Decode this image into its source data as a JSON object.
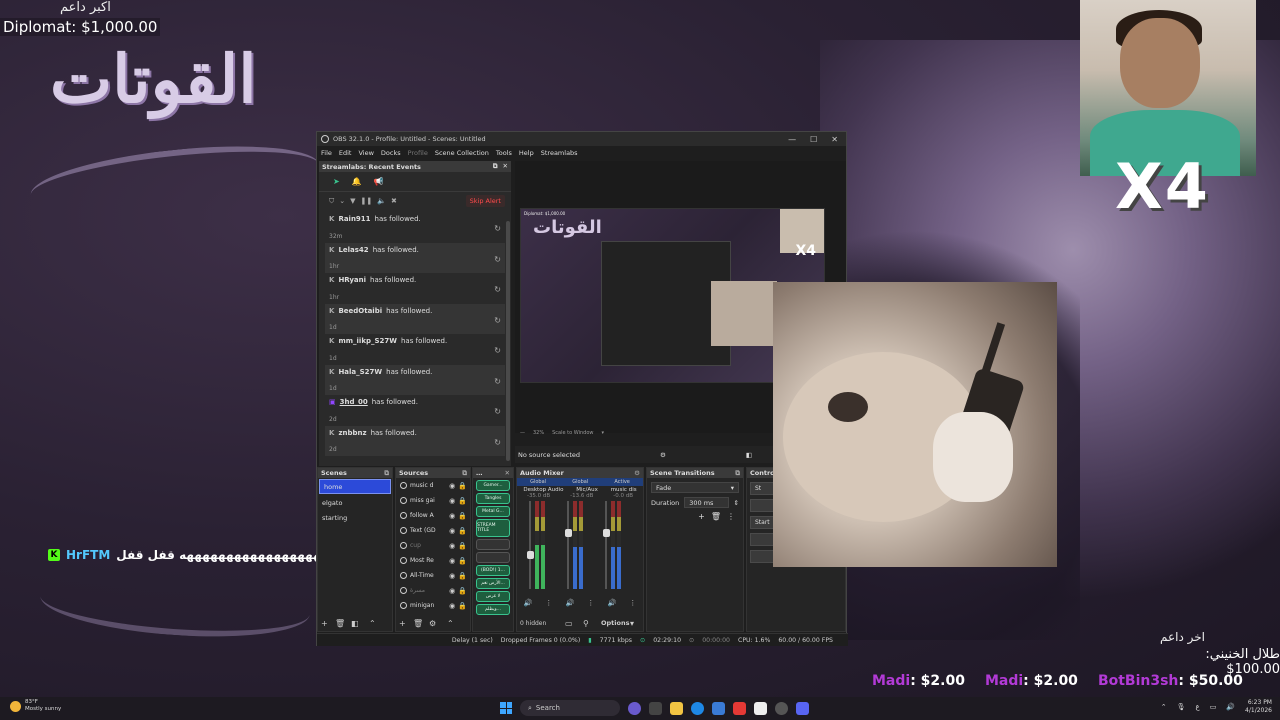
{
  "overlay": {
    "top_left_label": "اكبر داعم",
    "top_left_diplomat": "Diplomat: $1,000.00",
    "big_title": "القوتات",
    "cam_badge": "X4",
    "chat": {
      "user": "HrFTM",
      "message": "ههههههههههههههههههههه قفل قفل"
    },
    "bottom_right_label": "اخر داعم",
    "bottom_right_amount": "طلال الخنيني: 100.00$",
    "donors": [
      {
        "name": "Madi",
        "amount": ": $2.00"
      },
      {
        "name": "Madi",
        "amount": ": $2.00"
      },
      {
        "name": "BotBin3sh",
        "amount": ": $50.00"
      }
    ]
  },
  "obs": {
    "title": "OBS 32.1.0 - Profile: Untitled - Scenes: Untitled",
    "menu": [
      "File",
      "Edit",
      "View",
      "Docks",
      "Profile",
      "Scene Collection",
      "Tools",
      "Help",
      "Streamlabs"
    ],
    "events_dock": {
      "title": "Streamlabs: Recent Events",
      "skip_alert": "Skip Alert",
      "events": [
        {
          "user": "Rain911",
          "action": "has followed.",
          "time": "32m",
          "platform": "kick"
        },
        {
          "user": "Lelas42",
          "action": "has followed.",
          "time": "1hr",
          "platform": "kick"
        },
        {
          "user": "HRyani",
          "action": "has followed.",
          "time": "1hr",
          "platform": "kick"
        },
        {
          "user": "BeedOtaibi",
          "action": "has followed.",
          "time": "1d",
          "platform": "kick"
        },
        {
          "user": "mm_iikp_S27W",
          "action": "has followed.",
          "time": "1d",
          "platform": "kick"
        },
        {
          "user": "Hala_S27W",
          "action": "has followed.",
          "time": "1d",
          "platform": "kick"
        },
        {
          "user": "3hd_00",
          "action": "has followed.",
          "time": "2d",
          "platform": "twitch"
        },
        {
          "user": "znbbnz",
          "action": "has followed.",
          "time": "2d",
          "platform": "kick"
        }
      ]
    },
    "preview": {
      "mini_label": "Diplomat: $1,000.00",
      "zoom": "32%",
      "scale_mode": "Scale to Window",
      "no_source": "No source selected"
    },
    "scenes": {
      "title": "Scenes",
      "items": [
        "home",
        "elgato",
        "starting"
      ],
      "selected": "home"
    },
    "sources": {
      "title": "Sources",
      "items": [
        {
          "name": "music d",
          "dim": false
        },
        {
          "name": "miss gai",
          "dim": false
        },
        {
          "name": "follow A",
          "dim": false
        },
        {
          "name": "Text (GD",
          "dim": false
        },
        {
          "name": "cup",
          "dim": true
        },
        {
          "name": "Most Re",
          "dim": false
        },
        {
          "name": "All-Time",
          "dim": false
        },
        {
          "name": "مسرة",
          "dim": true
        },
        {
          "name": "minigan",
          "dim": false
        }
      ],
      "hidden_count": "0 hidden"
    },
    "chat_chips": [
      "Gamer...",
      "Tangles",
      "Metal G...",
      "STREAM TITLE",
      "",
      "",
      "(BOD!) 1...",
      "الأرض نغم...",
      "لا غرض",
      "ويظلم...",
      "غزلات",
      "Bitwarden"
    ],
    "mixer": {
      "title": "Audio Mixer",
      "tabs": [
        "Global",
        "Global",
        "Active"
      ],
      "channels": [
        {
          "name": "Desktop Audio",
          "db": "-35.0 dB",
          "fill": 0.25
        },
        {
          "name": "Mic/Aux",
          "db": "-13.6 dB",
          "fill": 0.0
        },
        {
          "name": "music dis",
          "db": "-0.0 dB",
          "fill": 0.0
        }
      ],
      "options_label": "Options"
    },
    "transitions": {
      "title": "Scene Transitions",
      "selected": "Fade",
      "duration_label": "Duration",
      "duration_value": "300 ms"
    },
    "controls": {
      "title": "Controls",
      "buttons": [
        "St",
        "",
        "Start",
        "",
        ""
      ]
    },
    "status": {
      "delay": "Delay (1 sec)",
      "dropped": "Dropped Frames 0 (0.0%)",
      "bitrate": "7771 kbps",
      "stream_time": "02:29:10",
      "rec_time": "00:00:00",
      "cpu": "CPU: 1.6%",
      "fps": "60.00 / 60.00 FPS"
    }
  },
  "taskbar": {
    "weather_temp": "83°F",
    "weather_desc": "Mostly sunny",
    "search_label": "Search",
    "lang": "ع",
    "time": "6:23 PM",
    "date": "4/1/2026"
  },
  "colors": {
    "accent_green": "#39c38e",
    "kick_green": "#53fc18",
    "donor_purple": "#b23ad6",
    "selected_scene": "#2c4ad9"
  }
}
